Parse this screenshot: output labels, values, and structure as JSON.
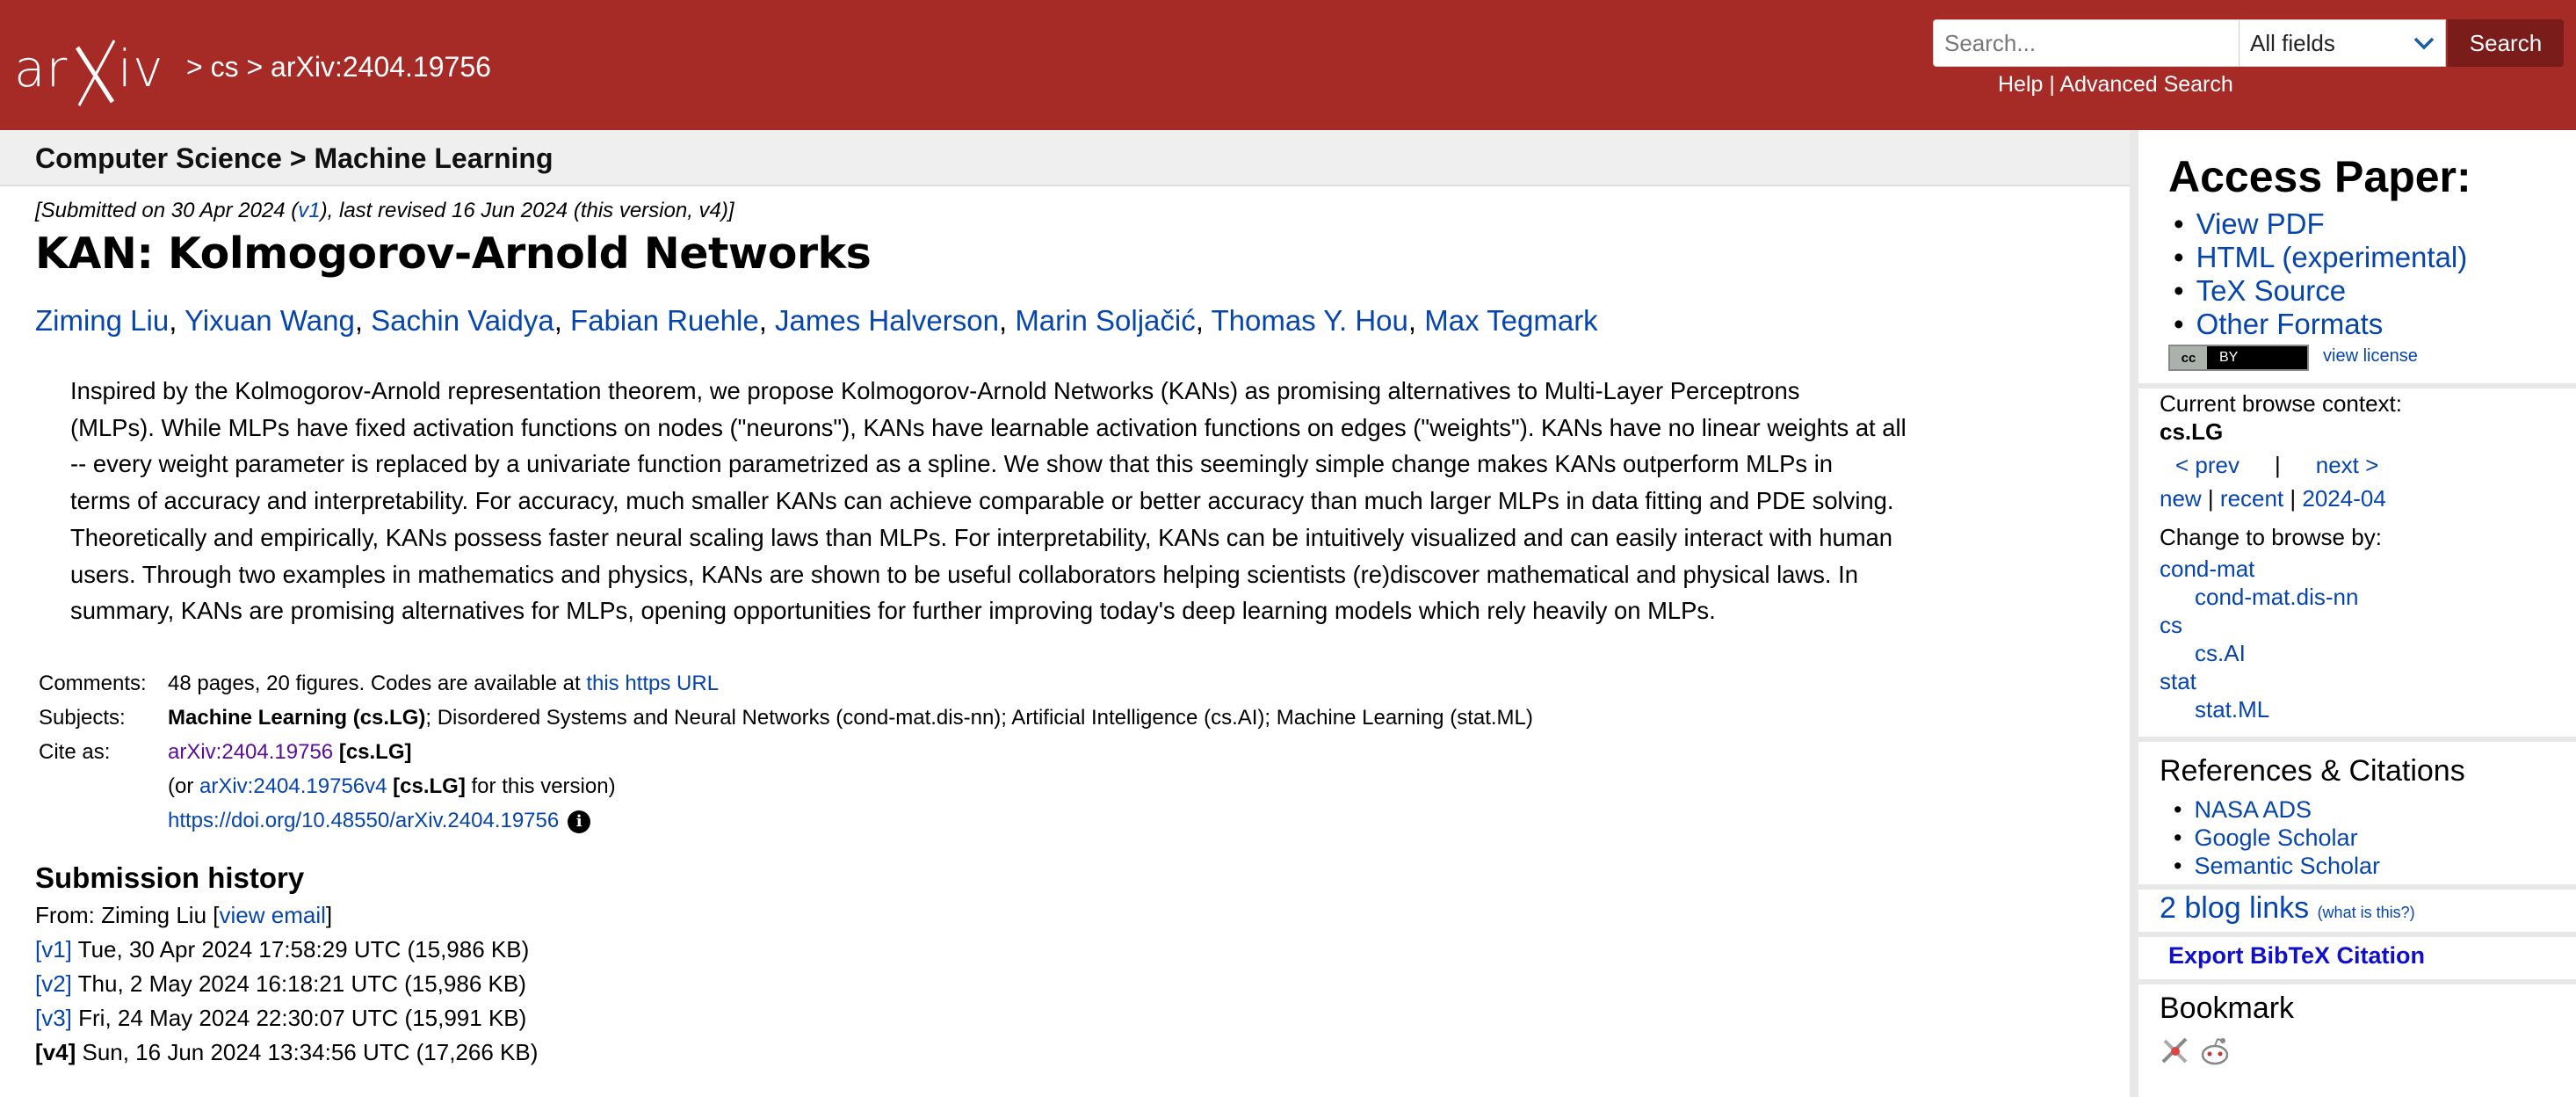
{
  "header": {
    "logo_text": "arXiv",
    "breadcrumb": "> cs > arXiv:2404.19756",
    "search_placeholder": "Search...",
    "field_select": "All fields",
    "search_button": "Search",
    "help": "Help",
    "separator": " | ",
    "advanced_search": "Advanced Search",
    "colors": {
      "brand": "#a62a26",
      "button": "#7a1c19"
    }
  },
  "subject_bar": "Computer Science > Machine Learning",
  "dateline": {
    "pre": "[Submitted on 30 Apr 2024 (",
    "v1": "v1",
    "post": "), last revised 16 Jun 2024 (this version, v4)]"
  },
  "title": "KAN: Kolmogorov-Arnold Networks",
  "authors": [
    "Ziming Liu",
    "Yixuan Wang",
    "Sachin Vaidya",
    "Fabian Ruehle",
    "James Halverson",
    "Marin Soljačić",
    "Thomas Y. Hou",
    "Max Tegmark"
  ],
  "abstract": [
    "Inspired by the Kolmogorov-Arnold representation theorem, we propose Kolmogorov-Arnold Networks (KANs) as promising alternatives to Multi-Layer Perceptrons",
    "(MLPs). While MLPs have fixed activation functions on nodes (\"neurons\"), KANs have learnable activation functions on edges (\"weights\"). KANs have no linear weights at all",
    "-- every weight parameter is replaced by a univariate function parametrized as a spline. We show that this seemingly simple change makes KANs outperform MLPs in",
    "terms of accuracy and interpretability. For accuracy, much smaller KANs can achieve comparable or better accuracy than much larger MLPs in data fitting and PDE solving.",
    "Theoretically and empirically, KANs possess faster neural scaling laws than MLPs. For interpretability, KANs can be intuitively visualized and can easily interact with human",
    "users. Through two examples in mathematics and physics, KANs are shown to be useful collaborators helping scientists (re)discover mathematical and physical laws. In",
    "summary, KANs are promising alternatives for MLPs, opening opportunities for further improving today's deep learning models which rely heavily on MLPs."
  ],
  "meta": {
    "comments_label": "Comments:",
    "comments_text": "48 pages, 20 figures. Codes are available at ",
    "comments_link": "this https URL",
    "subjects_label": "Subjects:",
    "subjects_primary": "Machine Learning (cs.LG)",
    "subjects_rest": "; Disordered Systems and Neural Networks (cond-mat.dis-nn); Artificial Intelligence (cs.AI); Machine Learning (stat.ML)",
    "cite_label": "Cite as:",
    "cite_id": "arXiv:2404.19756",
    "cite_tag": " [cs.LG]",
    "cite2_pre": "(or ",
    "cite2_link": "arXiv:2404.19756v4",
    "cite2_tag": " [cs.LG]",
    "cite2_post": " for this version)",
    "doi": "https://doi.org/10.48550/arXiv.2404.19756"
  },
  "history": {
    "title": "Submission history",
    "from_pre": "From: Ziming Liu [",
    "from_link": "view email",
    "from_post": "]",
    "versions": [
      {
        "label": "[v1]",
        "text": " Tue, 30 Apr 2024 17:58:29 UTC (15,986 KB)"
      },
      {
        "label": "[v2]",
        "text": " Thu, 2 May 2024 16:18:21 UTC (15,986 KB)"
      },
      {
        "label": "[v3]",
        "text": " Fri, 24 May 2024 22:30:07 UTC (15,991 KB)"
      },
      {
        "label": "[v4]",
        "text": " Sun, 16 Jun 2024 13:34:56 UTC (17,266 KB)"
      }
    ]
  },
  "sidebar": {
    "access_title": "Access Paper:",
    "access_links": [
      "View PDF",
      "HTML (experimental)",
      "TeX Source",
      "Other Formats"
    ],
    "cc_badge": "BY",
    "view_license": "view license",
    "browse_context_label": "Current browse context:",
    "browse_context": "cs.LG",
    "prev": "< prev",
    "bar": "|",
    "next": "next >",
    "new": "new",
    "recent": "recent",
    "month": "2024-04",
    "change_browse": "Change to browse by:",
    "browse": [
      "cond-mat",
      "cond-mat.dis-nn",
      "cs",
      "cs.AI",
      "stat",
      "stat.ML"
    ],
    "refs_title": "References & Citations",
    "refs": [
      "NASA ADS",
      "Google Scholar",
      "Semantic Scholar"
    ],
    "blog_links": "2 blog links",
    "what_is_this": "(what is this?)",
    "bibtex": "Export BibTeX Citation",
    "bookmark": "Bookmark"
  }
}
